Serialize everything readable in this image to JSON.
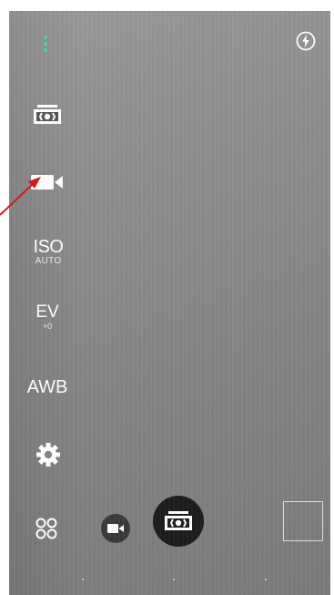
{
  "sidebar": {
    "menu_icon": "more-vert-icon",
    "camera_mode_icon": "camera-icon",
    "video_mode_icon": "videocam-icon",
    "iso": {
      "label": "ISO",
      "value": "AUTO"
    },
    "ev": {
      "label": "EV",
      "value": "+0"
    },
    "awb_label": "AWB",
    "settings_icon": "gear-icon",
    "modes_icon": "modes-icon"
  },
  "topbar": {
    "flash_icon": "flash-auto-icon"
  },
  "bottombar": {
    "video_button_icon": "videocam-icon",
    "shutter_icon": "camera-icon",
    "gallery_thumbnail": "gallery-thumbnail"
  },
  "annotation": {
    "arrow_color": "#d01c1f"
  },
  "colors": {
    "menu_dots": "#4fd1b5",
    "shutter": "#1d1d1d",
    "video_button": "#3a3a3a"
  }
}
